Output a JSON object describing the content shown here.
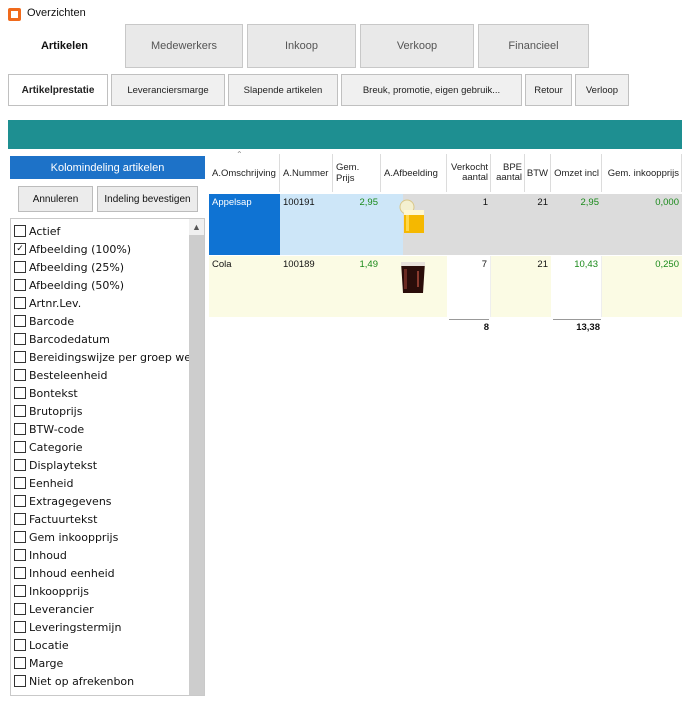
{
  "window": {
    "title": "Overzichten"
  },
  "main_tabs": [
    "Artikelen",
    "Medewerkers",
    "Inkoop",
    "Verkoop",
    "Financieel"
  ],
  "sub_tabs": [
    "Artikelprestatie",
    "Leveranciersmarge",
    "Slapende artikelen",
    "Breuk, promotie, eigen gebruik...",
    "Retour",
    "Verloop"
  ],
  "left_panel": {
    "header": "Kolomindeling artikelen",
    "cancel_label": "Annuleren",
    "confirm_label": "Indeling bevestigen",
    "items": [
      {
        "label": "Actief",
        "checked": false
      },
      {
        "label": "Afbeelding (100%)",
        "checked": true
      },
      {
        "label": "Afbeelding (25%)",
        "checked": false
      },
      {
        "label": "Afbeelding (50%)",
        "checked": false
      },
      {
        "label": "Artnr.Lev.",
        "checked": false
      },
      {
        "label": "Barcode",
        "checked": false
      },
      {
        "label": "Barcodedatum",
        "checked": false
      },
      {
        "label": "Bereidingswijze per groep weer",
        "checked": false
      },
      {
        "label": "Besteleenheid",
        "checked": false
      },
      {
        "label": "Bontekst",
        "checked": false
      },
      {
        "label": "Brutoprijs",
        "checked": false
      },
      {
        "label": "BTW-code",
        "checked": false
      },
      {
        "label": "Categorie",
        "checked": false
      },
      {
        "label": "Displaytekst",
        "checked": false
      },
      {
        "label": "Eenheid",
        "checked": false
      },
      {
        "label": "Extragegevens",
        "checked": false
      },
      {
        "label": "Factuurtekst",
        "checked": false
      },
      {
        "label": "Gem inkoopprijs",
        "checked": false
      },
      {
        "label": "Inhoud",
        "checked": false
      },
      {
        "label": "Inhoud eenheid",
        "checked": false
      },
      {
        "label": "Inkoopprijs",
        "checked": false
      },
      {
        "label": "Leverancier",
        "checked": false
      },
      {
        "label": "Leveringstermijn",
        "checked": false
      },
      {
        "label": "Locatie",
        "checked": false
      },
      {
        "label": "Marge",
        "checked": false
      },
      {
        "label": "Niet op afrekenbon",
        "checked": false
      }
    ]
  },
  "grid": {
    "columns": [
      "A.Omschrijving",
      "A.Nummer",
      "Gem. Prijs",
      "A.Afbeelding",
      "Verkocht aantal",
      "BPE aantal",
      "BTW",
      "Omzet incl",
      "Gem. inkoopprijs"
    ],
    "rows": [
      {
        "omschrijving": "Appelsap",
        "nummer": "100191",
        "prijs": "2,95",
        "afbeelding": "apple-juice-image",
        "verkocht": "1",
        "bpe": "",
        "btw": "21",
        "omzet": "2,95",
        "inkoop": "0,000"
      },
      {
        "omschrijving": "Cola",
        "nummer": "100189",
        "prijs": "1,49",
        "afbeelding": "cola-image",
        "verkocht": "7",
        "bpe": "",
        "btw": "21",
        "omzet": "10,43",
        "inkoop": "0,250"
      }
    ],
    "totals": {
      "verkocht": "8",
      "omzet": "13,38"
    }
  },
  "colors": {
    "teal": "#1e8f91",
    "header_blue": "#1d72c8",
    "selection": "#0f73d3",
    "value_green": "#1a8a1a"
  }
}
